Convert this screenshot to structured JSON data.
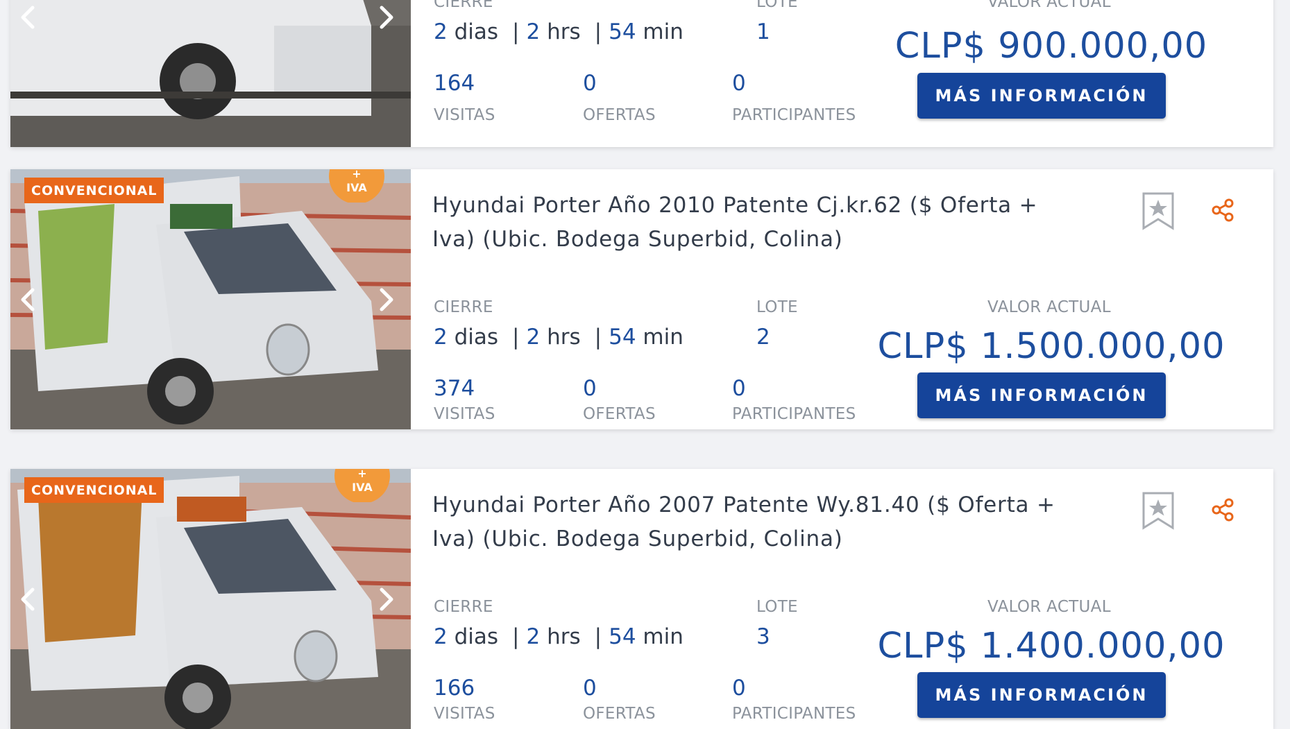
{
  "labels": {
    "cierre": "CIERRE",
    "lote": "LOTE",
    "valor_actual": "VALOR ACTUAL",
    "visitas": "VISITAS",
    "ofertas": "OFERTAS",
    "participantes": "PARTICIPANTES",
    "more_info": "MÁS INFORMACIÓN",
    "dias_unit": "dias",
    "hrs_unit": "hrs",
    "min_unit": "min",
    "sep": "|"
  },
  "lots": [
    {
      "badge": "",
      "title": "",
      "dias": "2",
      "hrs": "2",
      "min": "54",
      "lote": "1",
      "price": "CLP$ 900.000,00",
      "visitas": "164",
      "ofertas": "0",
      "participantes": "0"
    },
    {
      "badge": "CONVENCIONAL",
      "iva": "IVA",
      "title": "Hyundai Porter Año 2010 Patente Cj.kr.62 ($ Oferta + Iva) (Ubic. Bodega Superbid, Colina)",
      "dias": "2",
      "hrs": "2",
      "min": "54",
      "lote": "2",
      "price": "CLP$ 1.500.000,00",
      "visitas": "374",
      "ofertas": "0",
      "participantes": "0"
    },
    {
      "badge": "CONVENCIONAL",
      "iva": "IVA",
      "title": "Hyundai Porter Año 2007 Patente Wy.81.40 ($ Oferta + Iva) (Ubic. Bodega Superbid, Colina)",
      "dias": "2",
      "hrs": "2",
      "min": "54",
      "lote": "3",
      "price": "CLP$ 1.400.000,00",
      "visitas": "166",
      "ofertas": "0",
      "participantes": "0"
    }
  ],
  "colors": {
    "accent": "#1d4e9e",
    "button": "#15449a",
    "badge": "#e8661a",
    "text": "#333c4a",
    "label": "#8b929b"
  },
  "icons": [
    "chevron-left-icon",
    "chevron-right-icon",
    "star-bookmark-icon",
    "share-icon",
    "iva-icon"
  ]
}
